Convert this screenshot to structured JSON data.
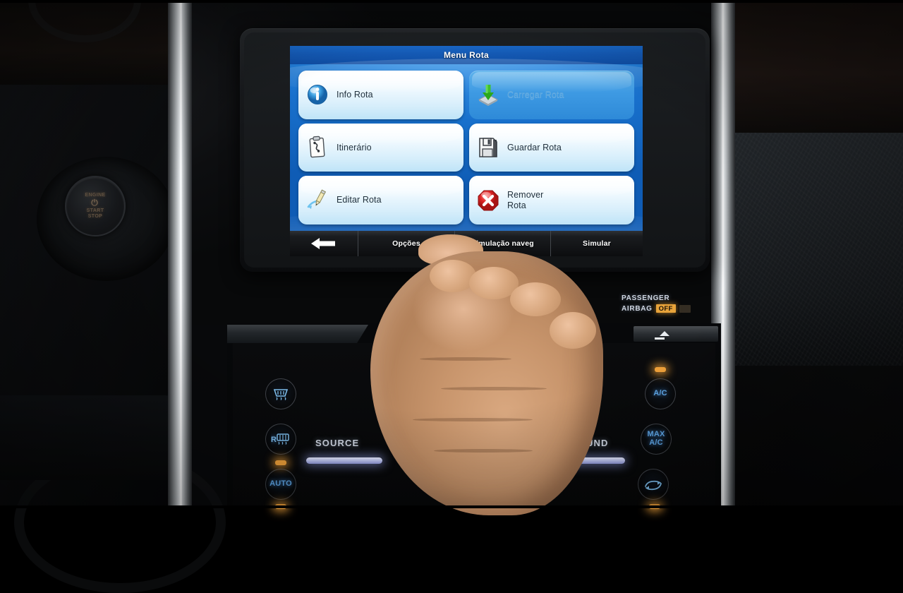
{
  "scene": {
    "description": "Car dashboard with in-dash navigation touchscreen, hand reaching to touch bottom toolbar",
    "vehicle_controls": {
      "ignition": {
        "line1": "ENGINE",
        "power_glyph": "⏻",
        "line2": "START",
        "line3": "STOP",
        "name": "engine-start-stop-button"
      },
      "airbag_indicator": {
        "line1": "PASSENGER",
        "line2": "AIRBAG",
        "status": "OFF",
        "status_color": "#e8a33a"
      },
      "media": {
        "eject_label": "eject",
        "source_label": "SOURCE",
        "sound_label": "SOUND"
      },
      "climate_left": [
        {
          "id": "front-defrost",
          "label": "",
          "icon": "defrost-front-icon",
          "led": false
        },
        {
          "id": "rear-defrost",
          "label": "R",
          "icon": "defrost-rear-icon",
          "led": true
        },
        {
          "id": "auto-climate",
          "label": "AUTO",
          "icon": "auto-icon",
          "led": true
        }
      ],
      "climate_right": [
        {
          "id": "ac",
          "label": "A/C",
          "icon": "ac-icon",
          "led": true
        },
        {
          "id": "max-ac",
          "label": "MAX\nA/C",
          "icon": "max-ac-icon",
          "led": false
        },
        {
          "id": "recirculate",
          "label": "",
          "icon": "recirculate-icon",
          "led": true
        }
      ]
    }
  },
  "nav": {
    "title": "Menu Rota",
    "buttons": [
      {
        "id": "info-rota",
        "label": "Info Rota",
        "icon": "info-icon",
        "disabled": false
      },
      {
        "id": "carregar-rota",
        "label": "Carregar Rota",
        "icon": "load-icon",
        "disabled": true
      },
      {
        "id": "itinerario",
        "label": "Itinerário",
        "icon": "clipboard-icon",
        "disabled": false
      },
      {
        "id": "guardar-rota",
        "label": "Guardar Rota",
        "icon": "floppy-icon",
        "disabled": false
      },
      {
        "id": "editar-rota",
        "label": "Editar Rota",
        "icon": "pencil-icon",
        "disabled": false
      },
      {
        "id": "remover-rota",
        "label": "Remover\nRota",
        "icon": "delete-icon",
        "disabled": false
      }
    ],
    "bottom_bar": {
      "back_label": "",
      "back_icon": "back-arrow-icon",
      "options_label": "Opções",
      "sim_nav_label": "Simulação naveg",
      "simulate_label": "Simular"
    },
    "colors": {
      "title_bar": "#1459b4",
      "background": "#1870cc",
      "button_face": "#e8f6fd",
      "disabled_face": "#3e9ae3",
      "label_text": "#23323d"
    }
  }
}
